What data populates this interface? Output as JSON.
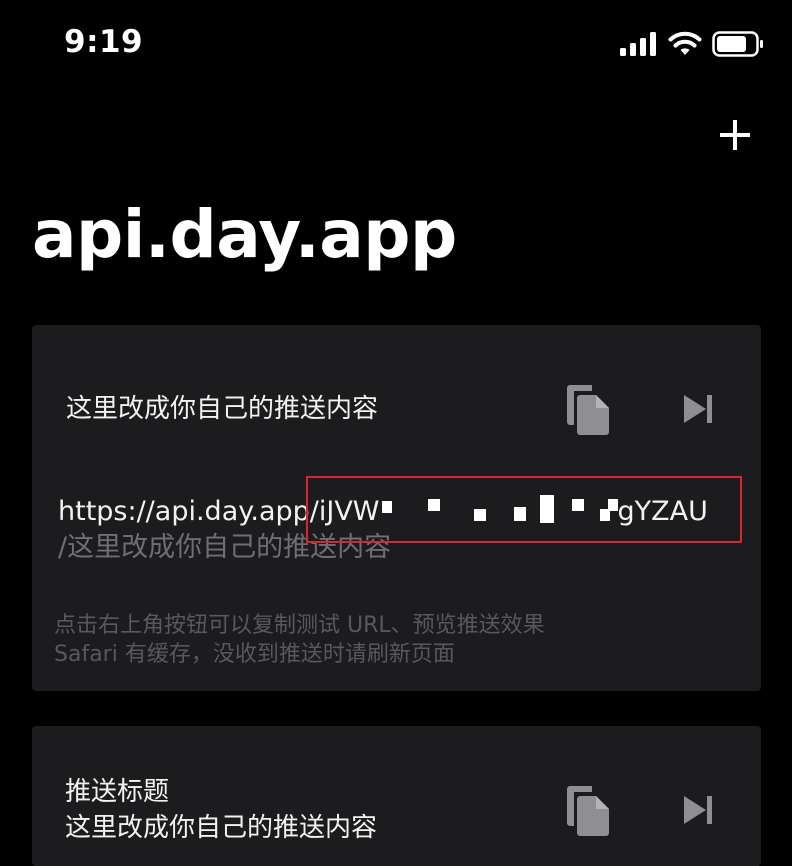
{
  "status_bar": {
    "time": "9:19",
    "icons": [
      "cellular-signal-icon",
      "wifi-icon",
      "battery-icon"
    ]
  },
  "header": {
    "add_icon": "plus-icon",
    "title": "api.day.app"
  },
  "card1": {
    "text": "这里改成你自己的推送内容",
    "copy_icon": "copy-icon",
    "preview_icon": "skip-forward-icon",
    "url_prefix": "https://api.day.app/",
    "url_key_start": "iJVW",
    "url_key_end": "gYZAU",
    "url_path": "/这里改成你自己的推送内容",
    "hint_line1": "点击右上角按钮可以复制测试 URL、预览推送效果",
    "hint_line2": "Safari 有缓存，没收到推送时请刷新页面"
  },
  "card2": {
    "title": "推送标题",
    "text": "这里改成你自己的推送内容",
    "copy_icon": "copy-icon",
    "preview_icon": "skip-forward-icon"
  },
  "colors": {
    "background": "#000000",
    "card": "#1c1c1e",
    "primary_text": "#f2f2f2",
    "secondary_text": "#6e6e73",
    "hint_text": "#58585d",
    "icon_gray": "#8e8e93",
    "highlight": "#d9252b"
  }
}
